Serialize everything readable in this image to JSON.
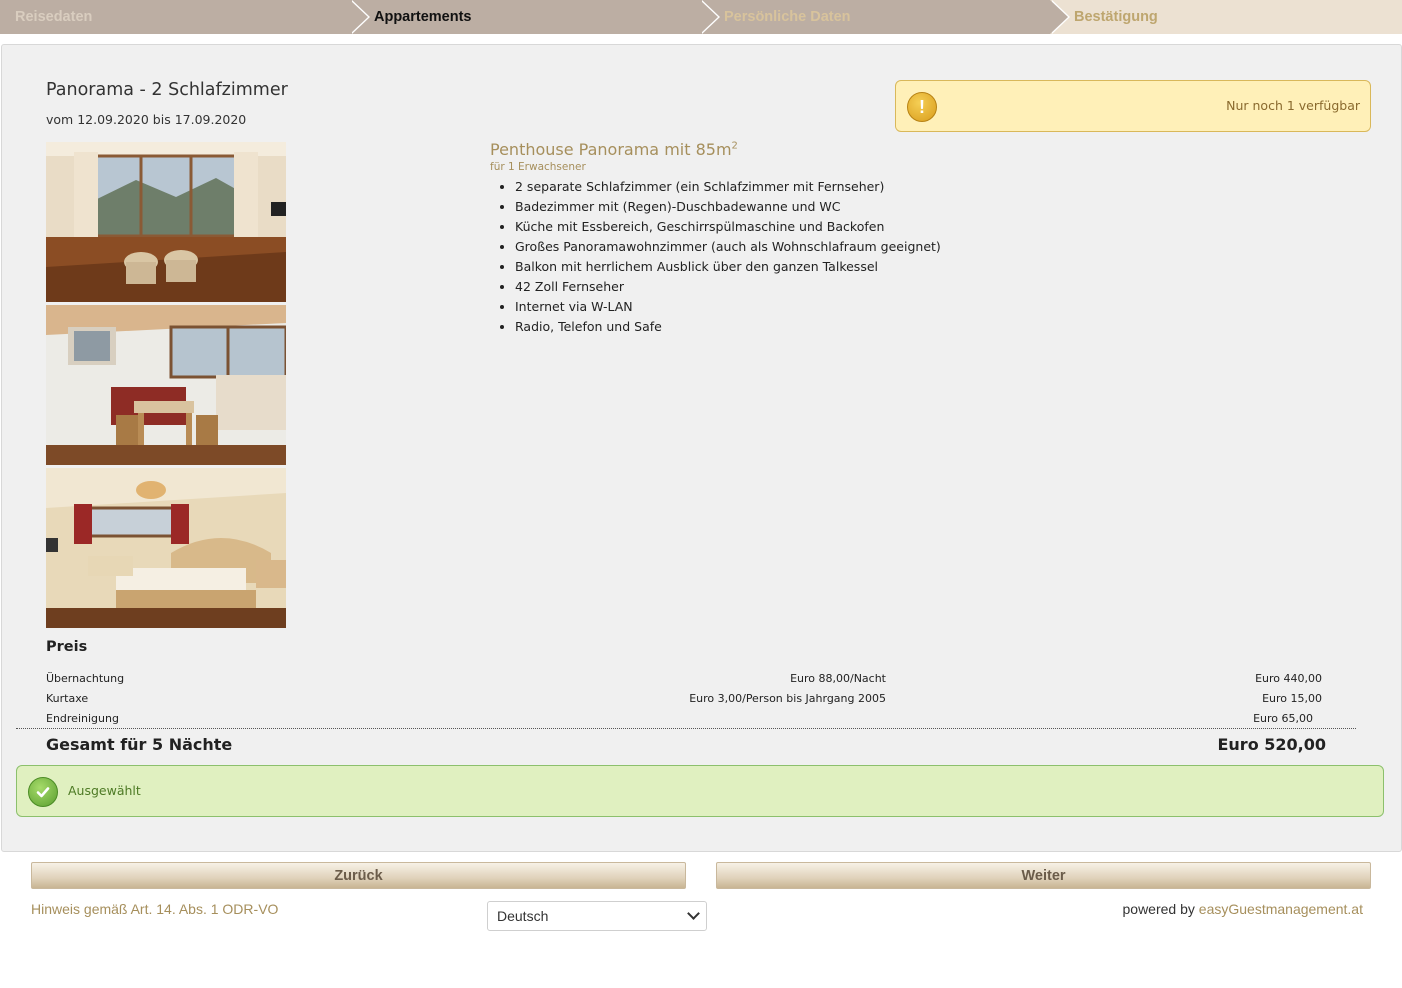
{
  "steps": [
    {
      "label": "Reisedaten",
      "state": "done"
    },
    {
      "label": "Appartements",
      "state": "active"
    },
    {
      "label": "Persönliche Daten",
      "state": "todo"
    },
    {
      "label": "Bestätigung",
      "state": "todo"
    }
  ],
  "room": {
    "title": "Panorama - 2 Schlafzimmer",
    "dates_prefix": "vom",
    "date_from": "12.09.2020",
    "dates_mid": "bis",
    "date_to": "17.09.2020"
  },
  "availability": {
    "text": "Nur noch 1 verfügbar",
    "icon": "warning-icon"
  },
  "description": {
    "title": "Penthouse Panorama mit 85m",
    "title_sup": "2",
    "subtitle": "für 1 Erwachsener",
    "features": [
      "2 separate Schlafzimmer (ein Schlafzimmer mit Fernseher)",
      "Badezimmer mit (Regen)-Duschbadewanne und WC",
      "Küche mit Essbereich, Geschirrspülmaschine und Backofen",
      "Großes Panoramawohnzimmer (auch als Wohnschlafraum geeignet)",
      "Balkon mit herrlichem Ausblick über den ganzen Talkessel",
      "42 Zoll Fernseher",
      "Internet via W-LAN",
      "Radio, Telefon und Safe"
    ]
  },
  "price": {
    "heading": "Preis",
    "rows": [
      {
        "name": "Übernachtung",
        "unit": "Euro 88,00/Nacht",
        "sum": "Euro 440,00"
      },
      {
        "name": "Kurtaxe",
        "unit": "Euro 3,00/Person bis Jahrgang 2005",
        "sum": "Euro 15,00"
      },
      {
        "name": "Endreinigung",
        "unit": "",
        "sum": "Euro 65,00"
      }
    ],
    "total_label": "Gesamt für 5 Nächte",
    "total_amount": "Euro 520,00"
  },
  "selected": {
    "text": "Ausgewählt",
    "icon": "check-circle-icon"
  },
  "footer": {
    "back_label": "Zurück",
    "next_label": "Weiter",
    "hinweis": "Hinweis gemäß Art. 14. Abs. 1 ODR-VO",
    "language": "Deutsch",
    "powered_prefix": "powered by",
    "powered_link": "easyGuestmanagement.at"
  },
  "colors": {
    "accent": "#a68f5c",
    "step_bar": "#bcaea3",
    "warning_bg": "#fff0b8",
    "success_bg": "#e0f0c0"
  }
}
